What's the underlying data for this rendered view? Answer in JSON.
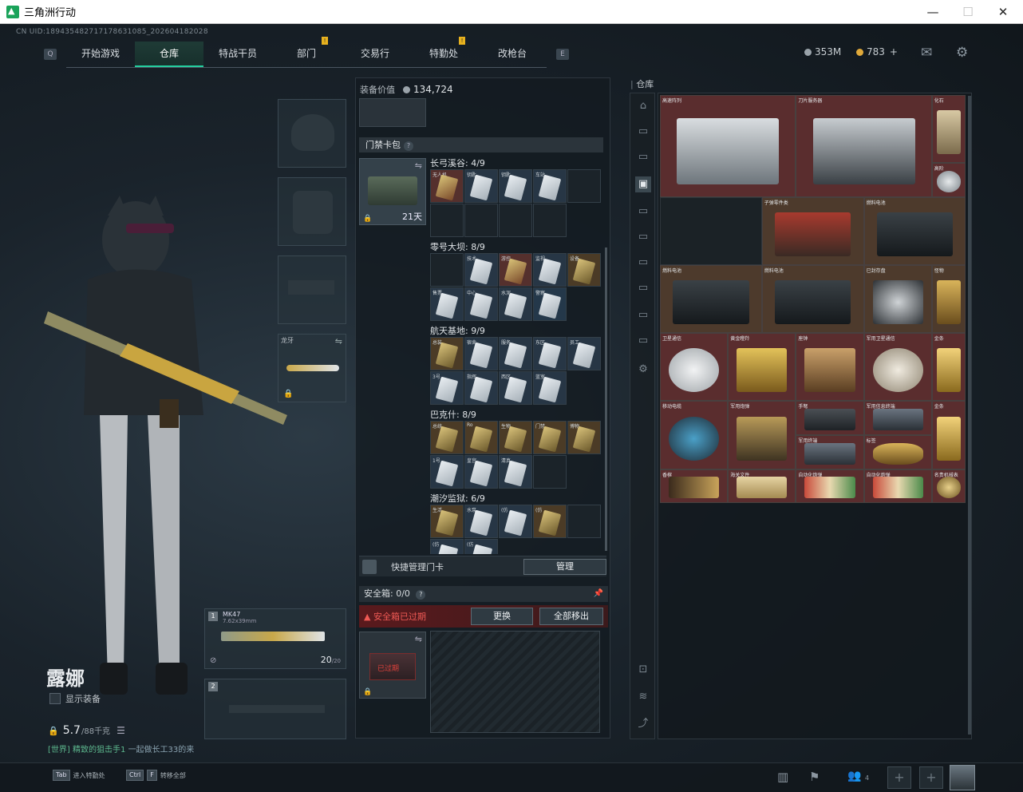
{
  "window": {
    "title": "三角洲行动",
    "min": "—",
    "max": "☐",
    "close": "✕"
  },
  "uid": "CN UID:189435482717178631085_202604182028",
  "nav": {
    "left_key": "Q",
    "right_key": "E",
    "tabs": [
      {
        "label": "开始游戏",
        "active": false,
        "badge": ""
      },
      {
        "label": "仓库",
        "active": true,
        "badge": ""
      },
      {
        "label": "特战干员",
        "active": false,
        "badge": ""
      },
      {
        "label": "部门",
        "active": false,
        "badge": "!"
      },
      {
        "label": "交易行",
        "active": false,
        "badge": ""
      },
      {
        "label": "特勤处",
        "active": false,
        "badge": "!"
      },
      {
        "label": "改枪台",
        "active": false,
        "badge": ""
      }
    ]
  },
  "currency": {
    "silver": "353M",
    "gold": "783",
    "gold_plus": "+"
  },
  "icons": {
    "mail": "mail-icon",
    "settings": "gear-icon"
  },
  "colors": {
    "accent": "#25d0a0",
    "warning": "#f05a55",
    "badge": "#e8b21e"
  },
  "equipment": {
    "melee_label": "龙牙",
    "weapon1": {
      "index": "1",
      "name": "MK47",
      "ammo_type": "7.62x39mm",
      "ammo": "20",
      "ammo_max": "/20"
    },
    "weapon2": {
      "index": "2"
    }
  },
  "character": {
    "name": "露娜",
    "show_equipment": "显示装备",
    "weight": "5.7",
    "weight_max": "/88千克",
    "chat_channel": "[世界]",
    "chat_user": "精致的狙击手1",
    "chat_msg": "一起做长工33的来"
  },
  "bottom": {
    "hints": [
      {
        "key": "Tab",
        "label": "进入特勤处"
      },
      {
        "key": "Ctrl",
        "key2": "F",
        "label": "转移全部"
      }
    ],
    "party_count": "4"
  },
  "middle": {
    "value_label": "装备价值",
    "value": "134,724",
    "keycard_section": "门禁卡包",
    "keycard_section_q": "?",
    "bag_days": "21天",
    "groups": [
      {
        "title": "长弓溪谷: 4/9",
        "labels": [
          "无人机",
          "钥匙",
          "钥匙",
          "车站"
        ]
      },
      {
        "title": "零号大坝: 8/9",
        "labels": [
          "技术",
          "游控",
          "监视",
          "设备",
          "售票",
          "中心",
          "水泥",
          "警察"
        ]
      },
      {
        "title": "航天基地: 9/9",
        "labels": [
          "总装",
          "宿舍",
          "服务",
          "东区",
          "员工",
          "3号",
          "指挥",
          "西区",
          "蓝室"
        ]
      },
      {
        "title": "巴克什: 8/9",
        "labels": [
          "总统",
          "Ro",
          "生物",
          "门禁",
          "博物",
          "1号",
          "皇宫",
          "清真"
        ]
      },
      {
        "title": "潮汐监狱: 6/9",
        "labels": [
          "生活",
          "水泵",
          "(仿",
          "(仿",
          "(仿",
          "(仿"
        ]
      }
    ],
    "quick_manage": "快捷管理门卡",
    "manage_btn": "管理",
    "safe_title": "安全箱: ",
    "safe_count": "0/0",
    "safe_q": "?",
    "safe_pin": "📌",
    "safe_expired": "安全箱已过期",
    "swap_btn": "更换",
    "move_all_btn": "全部移出",
    "safe_expired_badge": "已过期"
  },
  "warehouse": {
    "title": "仓库",
    "items": [
      {
        "label": "高速阵列",
        "color": "red"
      },
      {
        "label": "刀片服务器",
        "color": "red"
      },
      {
        "label": "化石",
        "color": "red"
      },
      {
        "label": "高阶",
        "color": "red"
      },
      {
        "label": "子弹零件类",
        "color": "tan"
      },
      {
        "label": "燃料电池",
        "color": "tan"
      },
      {
        "label": "燃料电池",
        "color": "tan"
      },
      {
        "label": "燃料电池",
        "color": "tan"
      },
      {
        "label": "已封存盘",
        "color": "tan"
      },
      {
        "label": "怪物",
        "color": "tan"
      },
      {
        "label": "卫星通信",
        "color": "red"
      },
      {
        "label": "黄金瞪羚",
        "color": "red"
      },
      {
        "label": "座钟",
        "color": "red"
      },
      {
        "label": "军用卫星通信",
        "color": "red"
      },
      {
        "label": "金条",
        "color": "red"
      },
      {
        "label": "移动电缆",
        "color": "red"
      },
      {
        "label": "军用炮弹",
        "color": "red"
      },
      {
        "label": "手弩",
        "color": "red"
      },
      {
        "label": "军用信息终端",
        "color": "red"
      },
      {
        "label": "金条",
        "color": "red"
      },
      {
        "label": "军用终端",
        "color": "red"
      },
      {
        "label": "标签",
        "color": "red"
      },
      {
        "label": "香槟",
        "color": "red"
      },
      {
        "label": "海关文件",
        "color": "red"
      },
      {
        "label": "自动化炮弹",
        "color": "red"
      },
      {
        "label": "自动化炮弹",
        "color": "red"
      },
      {
        "label": "名贵机械表",
        "color": "red"
      }
    ]
  }
}
